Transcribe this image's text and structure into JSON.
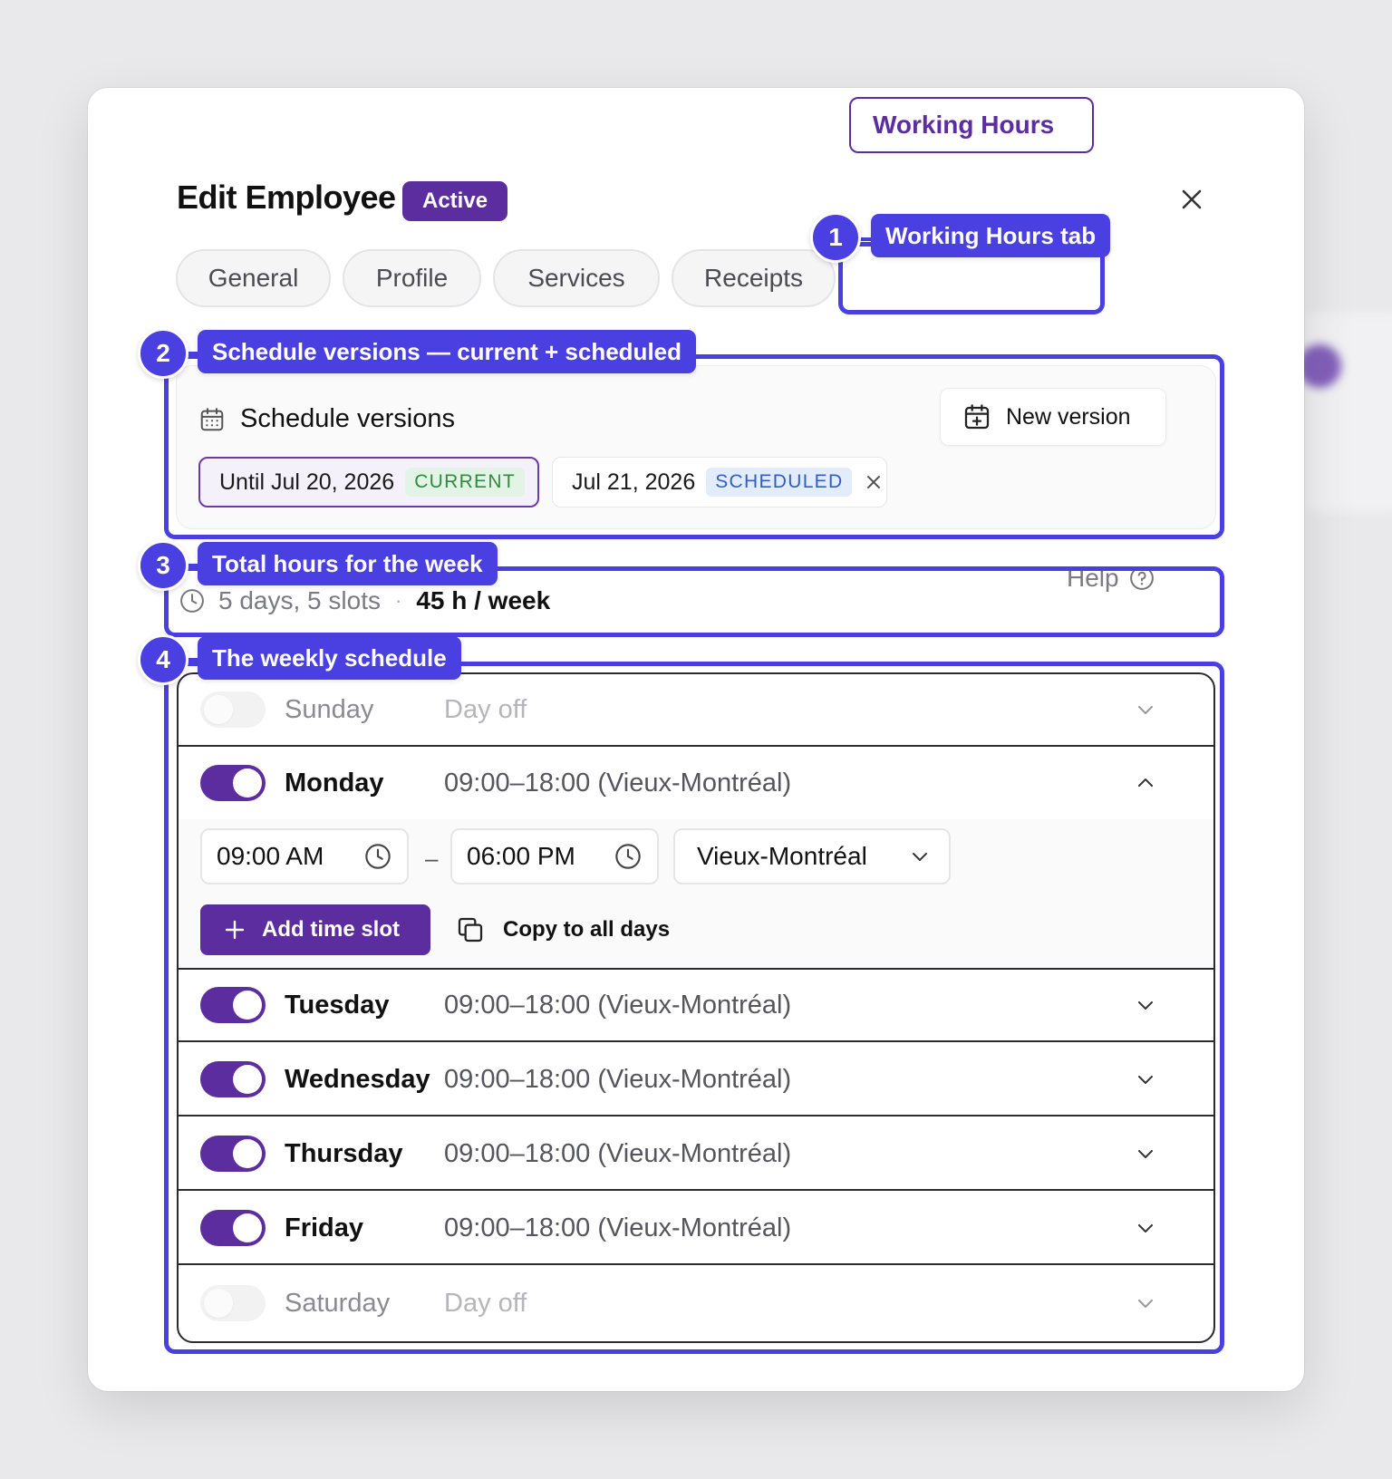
{
  "dialog": {
    "title": "Edit Employee",
    "status_badge": "Active",
    "tabs": [
      {
        "label": "General"
      },
      {
        "label": "Profile"
      },
      {
        "label": "Services"
      },
      {
        "label": "Receipts"
      },
      {
        "label": "Working Hours",
        "selected": true
      }
    ]
  },
  "schedule_versions": {
    "title": "Schedule versions",
    "new_version_label": "New version",
    "versions": [
      {
        "label": "Until Jul 20, 2026",
        "tag": "CURRENT",
        "selected": true
      },
      {
        "label": "Jul 21, 2026",
        "tag": "SCHEDULED",
        "removable": true
      }
    ]
  },
  "summary": {
    "days_slots": "5 days, 5 slots",
    "separator": "·",
    "total": "45 h / week",
    "help_label": "Help"
  },
  "schedule": {
    "days": [
      {
        "name": "Sunday",
        "enabled": false,
        "value": "Day off",
        "expanded": false
      },
      {
        "name": "Monday",
        "enabled": true,
        "value": "09:00–18:00 (Vieux-Montréal)",
        "expanded": true
      },
      {
        "name": "Tuesday",
        "enabled": true,
        "value": "09:00–18:00 (Vieux-Montréal)",
        "expanded": false
      },
      {
        "name": "Wednesday",
        "enabled": true,
        "value": "09:00–18:00 (Vieux-Montréal)",
        "expanded": false
      },
      {
        "name": "Thursday",
        "enabled": true,
        "value": "09:00–18:00 (Vieux-Montréal)",
        "expanded": false
      },
      {
        "name": "Friday",
        "enabled": true,
        "value": "09:00–18:00 (Vieux-Montréal)",
        "expanded": false
      },
      {
        "name": "Saturday",
        "enabled": false,
        "value": "Day off",
        "expanded": false
      }
    ],
    "monday_slot": {
      "start": "09:00 AM",
      "end": "06:00 PM",
      "separator": "–",
      "location": "Vieux-Montréal",
      "add_slot_label": "Add time slot",
      "copy_label": "Copy to all days"
    }
  },
  "annotations": [
    {
      "number": "1",
      "label": "Working Hours tab"
    },
    {
      "number": "2",
      "label": "Schedule versions — current + scheduled"
    },
    {
      "number": "3",
      "label": "Total hours for the week"
    },
    {
      "number": "4",
      "label": "The weekly schedule"
    }
  ],
  "colors": {
    "brand": "#5b2d9e",
    "annotation": "#4a3fe0",
    "current_tag": "#2f8c3f",
    "scheduled_tag": "#2f5fc4"
  },
  "icons": [
    "close-icon",
    "calendar-icon",
    "calendar-plus-icon",
    "clock-icon",
    "help-circle-icon",
    "chevron-down-icon",
    "chevron-up-icon",
    "plus-icon",
    "copy-icon"
  ]
}
